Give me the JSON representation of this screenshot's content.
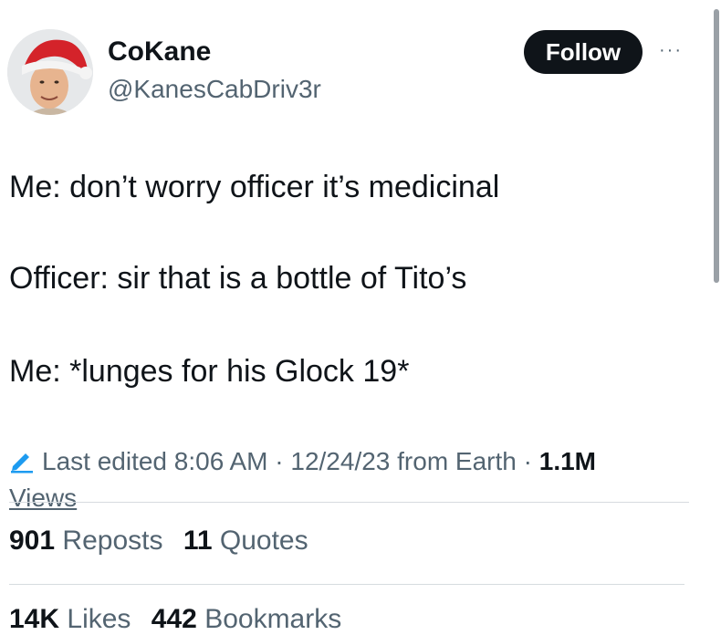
{
  "author": {
    "name": "CoKane",
    "handle": "@KanesCabDriv3r"
  },
  "follow_label": "Follow",
  "more_label": "···",
  "tweet_lines": [
    "Me: don’t worry officer it’s medicinal",
    "Officer: sir that is a bottle of Tito’s",
    "Me: *lunges for his Glock 19*"
  ],
  "meta": {
    "edited_text": "Last edited 8:06 AM · 12/24/23  from Earth ·",
    "views_count": "1.1M",
    "views_label": "Views"
  },
  "stats": {
    "reposts_count": "901",
    "reposts_label": "Reposts",
    "quotes_count": "11",
    "quotes_label": "Quotes",
    "likes_count": "14K",
    "likes_label": "Likes",
    "bookmarks_count": "442",
    "bookmarks_label": "Bookmarks"
  },
  "colors": {
    "text": "#0f1419",
    "secondary": "#536471",
    "edit_icon": "#1d9bf0",
    "santa_hat": "#d4232a"
  },
  "icons": {
    "edit": "pencil-icon",
    "avatar": "profile-photo-with-santa-hat"
  }
}
